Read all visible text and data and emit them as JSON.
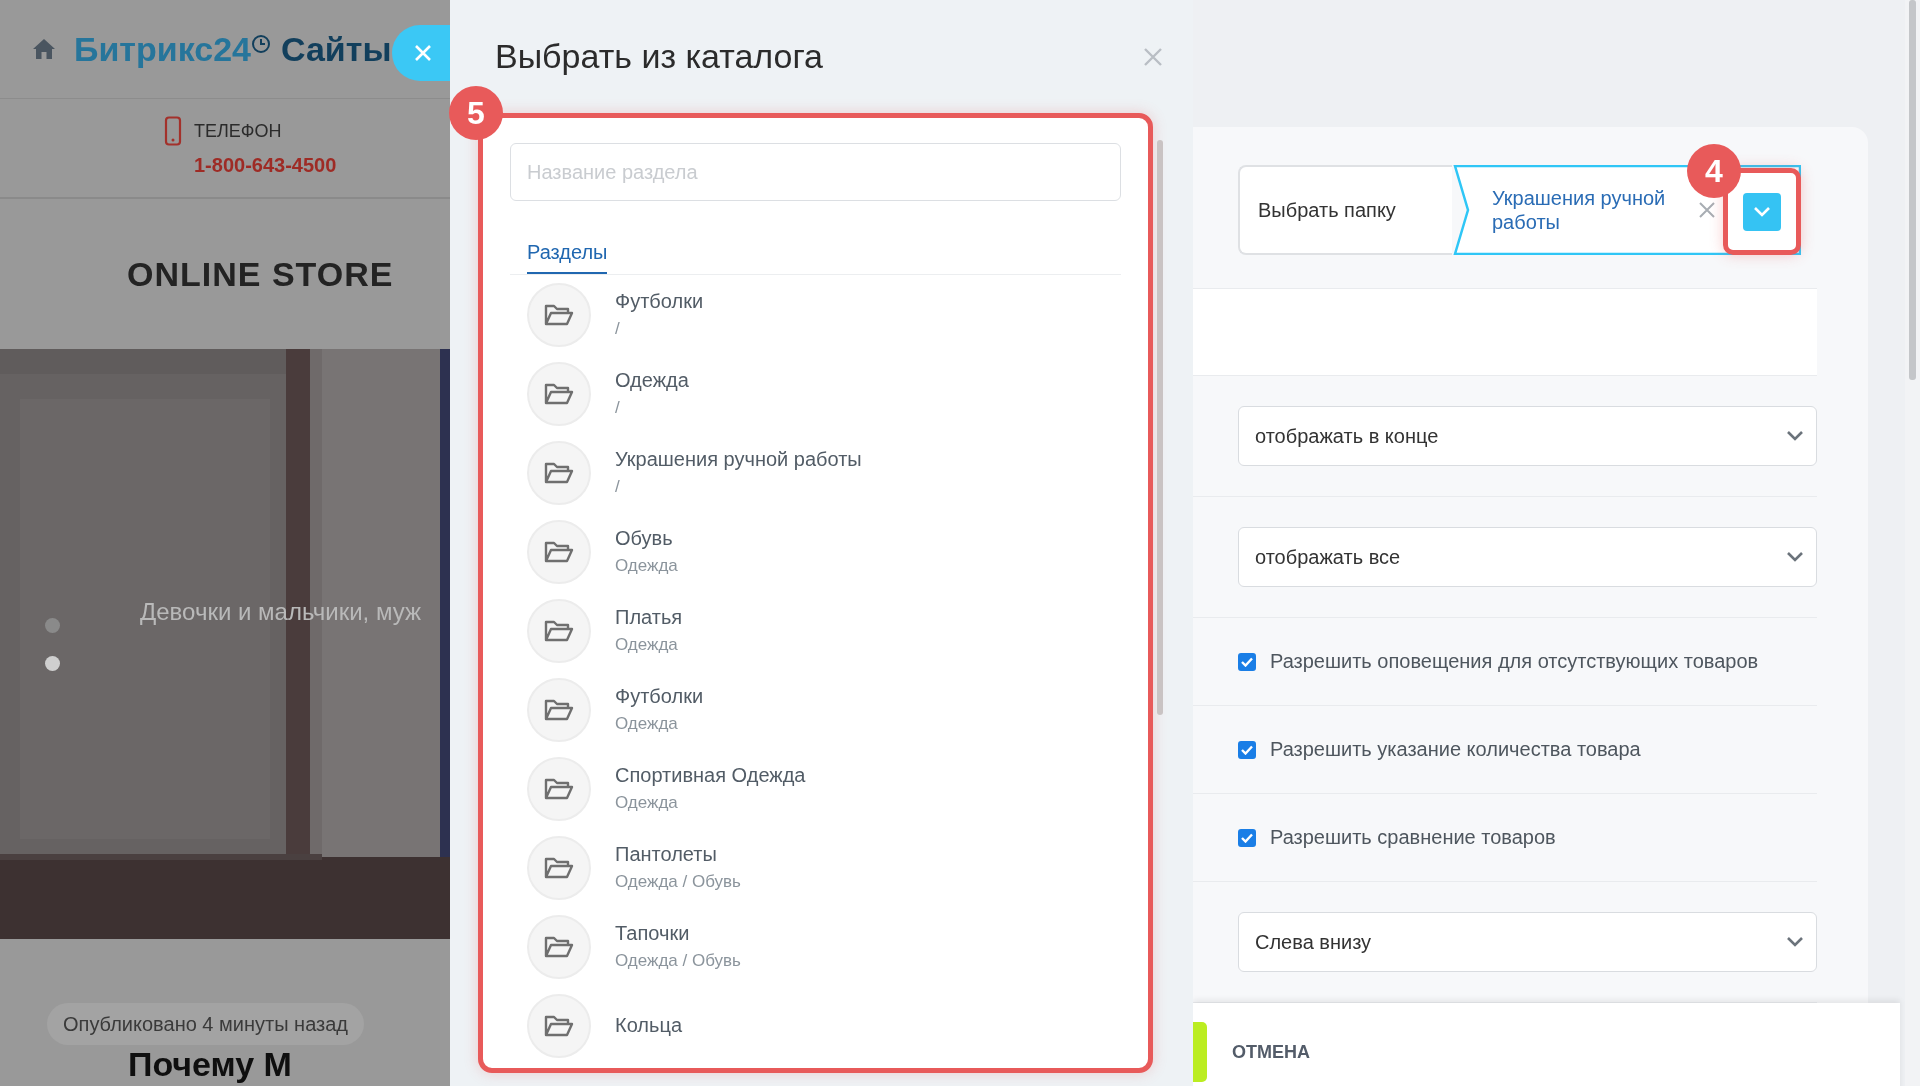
{
  "site": {
    "logo_brand": "Битрикс24",
    "logo_product": "Сайты",
    "phone_label": "ТЕЛЕФОН",
    "phone": "1-800-643-4500",
    "store_title": "ONLINE STORE",
    "slide_text": "Девочки и мальчики, муж",
    "slides": [
      {
        "selected": false
      },
      {
        "selected": true
      }
    ],
    "published": "Опубликовано 4 минуты назад",
    "heading": "Почему М"
  },
  "modal": {
    "title": "Выбрать из каталога",
    "badge": "5",
    "search": {
      "placeholder": "Название раздела"
    },
    "tabs": [
      {
        "label": "Разделы",
        "selected": true
      }
    ],
    "sections": [
      {
        "name": "Футболки",
        "path": "/"
      },
      {
        "name": "Одежда",
        "path": "/"
      },
      {
        "name": "Украшения ручной работы",
        "path": "/"
      },
      {
        "name": "Обувь",
        "path": "Одежда"
      },
      {
        "name": "Платья",
        "path": "Одежда"
      },
      {
        "name": "Футболки",
        "path": "Одежда"
      },
      {
        "name": "Спортивная Одежда",
        "path": "Одежда"
      },
      {
        "name": "Пантолеты",
        "path": "Одежда / Обувь"
      },
      {
        "name": "Тапочки",
        "path": "Одежда / Обувь"
      },
      {
        "name": "Кольца"
      }
    ]
  },
  "settings": {
    "folder_picker": {
      "label": "Выбрать папку",
      "value": "Украшения ручной работы",
      "badge": "4"
    },
    "fields": [
      {
        "kind": "blank"
      },
      {
        "kind": "select",
        "value": "отображать в конце"
      },
      {
        "kind": "select",
        "value": "отображать все"
      },
      {
        "kind": "checkbox",
        "label": "Разрешить оповещения для отсутствующих товаров",
        "checked": true
      },
      {
        "kind": "checkbox",
        "label": "Разрешить указание количества товара",
        "checked": true
      },
      {
        "kind": "checkbox",
        "label": "Разрешить сравнение товаров",
        "checked": true
      },
      {
        "kind": "select",
        "value": "Слева внизу"
      }
    ]
  },
  "footer": {
    "cancel": "ОТМЕНА"
  }
}
